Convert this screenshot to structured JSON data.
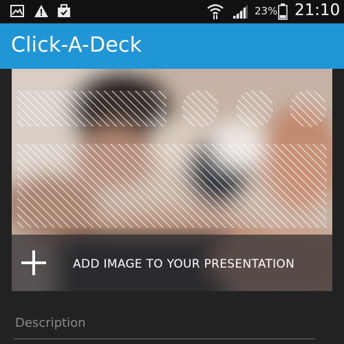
{
  "status_bar": {
    "icons": [
      "image-icon",
      "warning-icon",
      "briefcase-icon",
      "wifi-icon",
      "signal-icon",
      "battery-icon"
    ],
    "battery_percent": "23%",
    "time": "21:10"
  },
  "app_bar": {
    "title": "Click-A-Deck",
    "color": "#2196d6"
  },
  "image_card": {
    "add_image_label": "ADD IMAGE TO YOUR PRESENTATION",
    "add_icon": "plus-icon"
  },
  "description": {
    "placeholder": "Description",
    "value": ""
  }
}
